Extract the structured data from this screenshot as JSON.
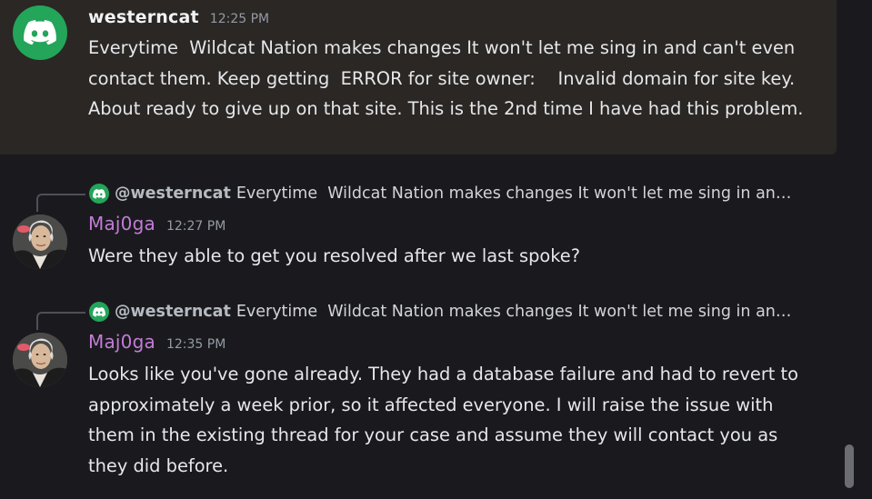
{
  "messages": [
    {
      "username": "westerncat",
      "timestamp": "12:25 PM",
      "avatar_icon": "discord-logo-icon",
      "content": "Everytime  Wildcat Nation makes changes It won't let me sing in and can't even contact them. Keep getting  ERROR for site owner:    Invalid domain for site key. About ready to give up on that site. This is the 2nd time I have had this problem."
    },
    {
      "reply": {
        "username": "@westerncat",
        "text": "Everytime  Wildcat Nation makes changes It won't let me sing in and …"
      },
      "username": "Maj0ga",
      "timestamp": "12:27 PM",
      "avatar_icon": "george-washington-avatar",
      "content": "Were they able to get you resolved after we last spoke?"
    },
    {
      "reply": {
        "username": "@westerncat",
        "text": "Everytime  Wildcat Nation makes changes It won't let me sing in and …"
      },
      "username": "Maj0ga",
      "timestamp": "12:35 PM",
      "avatar_icon": "george-washington-avatar",
      "content": "Looks like you've gone already. They had a database failure and had to revert to approximately a week prior, so it affected everyone. I will raise the issue with them in the existing thread for your case and assume they will contact you as they did before."
    }
  ],
  "colors": {
    "background": "#1a1a1e",
    "highlight": "#2a2724",
    "discord_green": "#23a55a",
    "username_purple": "#c27cd6"
  }
}
